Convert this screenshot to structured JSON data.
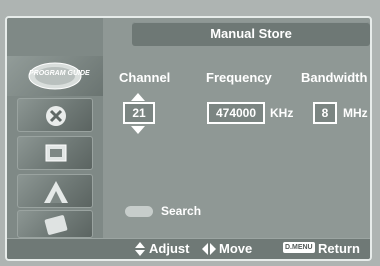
{
  "header": {
    "title": "Manual Store"
  },
  "sidebar": {
    "items": [
      {
        "icon": "program-guide-icon",
        "label": "PROGRAM GUIDE"
      },
      {
        "icon": "channel-setup-icon"
      },
      {
        "icon": "picture-icon"
      },
      {
        "icon": "setup-icon"
      },
      {
        "icon": "input-icon"
      }
    ]
  },
  "fields": {
    "channel": {
      "label": "Channel",
      "value": "21"
    },
    "frequency": {
      "label": "Frequency",
      "value": "474000",
      "unit": "KHz"
    },
    "bandwidth": {
      "label": "Bandwidth",
      "value": "8",
      "unit": "MHz"
    }
  },
  "search": {
    "label": "Search"
  },
  "footer": {
    "adjust": "Adjust",
    "move": "Move",
    "menu_badge": "D.MENU",
    "return": "Return"
  },
  "colors": {
    "background": "#aeb4b2",
    "panel": "#8f9895",
    "title_bar": "#6e7875",
    "text": "#ffffff"
  }
}
